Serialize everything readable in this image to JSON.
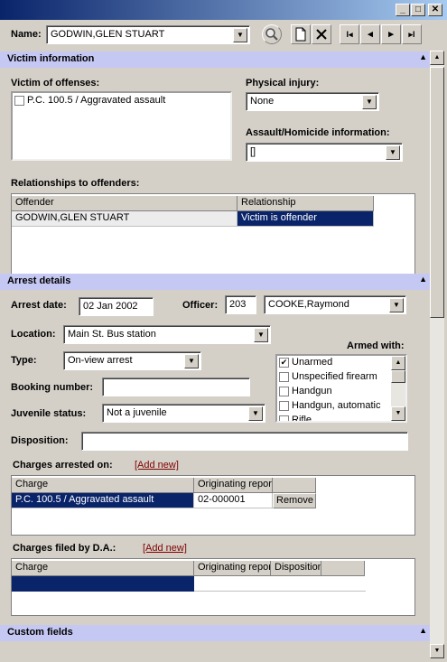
{
  "window": {
    "minimize_glyph": "_",
    "maximize_glyph": "□",
    "close_glyph": "✕"
  },
  "toolbar": {
    "name_label": "Name:",
    "name_value": "GODWIN,GLEN STUART",
    "first_glyph": "I◂",
    "prev_glyph": "◂",
    "next_glyph": "▸",
    "last_glyph": "▸I"
  },
  "victim": {
    "section_title": "Victim information",
    "offenses_label": "Victim of offenses:",
    "offenses": [
      {
        "label": "P.C. 100.5 / Aggravated assault",
        "checked": false
      }
    ],
    "physical_injury_label": "Physical injury:",
    "physical_injury_value": "None",
    "assault_label": "Assault/Homicide information:",
    "assault_value": "[]",
    "relationships_label": "Relationships to offenders:",
    "relationships_headers": [
      "Offender",
      "Relationship"
    ],
    "relationships_rows": [
      [
        "GODWIN,GLEN STUART",
        "Victim is offender"
      ]
    ]
  },
  "arrest": {
    "section_title": "Arrest details",
    "date_label": "Arrest date:",
    "date_value": "02 Jan 2002",
    "officer_label": "Officer:",
    "officer_id": "203",
    "officer_name": "COOKE,Raymond",
    "location_label": "Location:",
    "location_value": "Main St. Bus station",
    "type_label": "Type:",
    "type_value": "On-view arrest",
    "armed_label": "Armed with:",
    "armed_items": [
      {
        "label": "Unarmed",
        "checked": true
      },
      {
        "label": "Unspecified firearm",
        "checked": false
      },
      {
        "label": "Handgun",
        "checked": false
      },
      {
        "label": "Handgun, automatic",
        "checked": false
      },
      {
        "label": "Rifle",
        "checked": false
      }
    ],
    "booking_label": "Booking number:",
    "booking_value": "",
    "juvenile_label": "Juvenile status:",
    "juvenile_value": "Not a juvenile",
    "disposition_label": "Disposition:",
    "disposition_value": ""
  },
  "charges_arrested": {
    "label": "Charges arrested on:",
    "add_link": "[Add new]",
    "headers": [
      "Charge",
      "Originating report",
      ""
    ],
    "rows": [
      {
        "charge": "P.C. 100.5 / Aggravated assault",
        "report": "02-000001",
        "action": "Remove"
      }
    ]
  },
  "charges_filed": {
    "label": "Charges filed by D.A.:",
    "add_link": "[Add new]",
    "headers": [
      "Charge",
      "Originating report",
      "Disposition"
    ]
  },
  "custom": {
    "section_title": "Custom fields"
  }
}
